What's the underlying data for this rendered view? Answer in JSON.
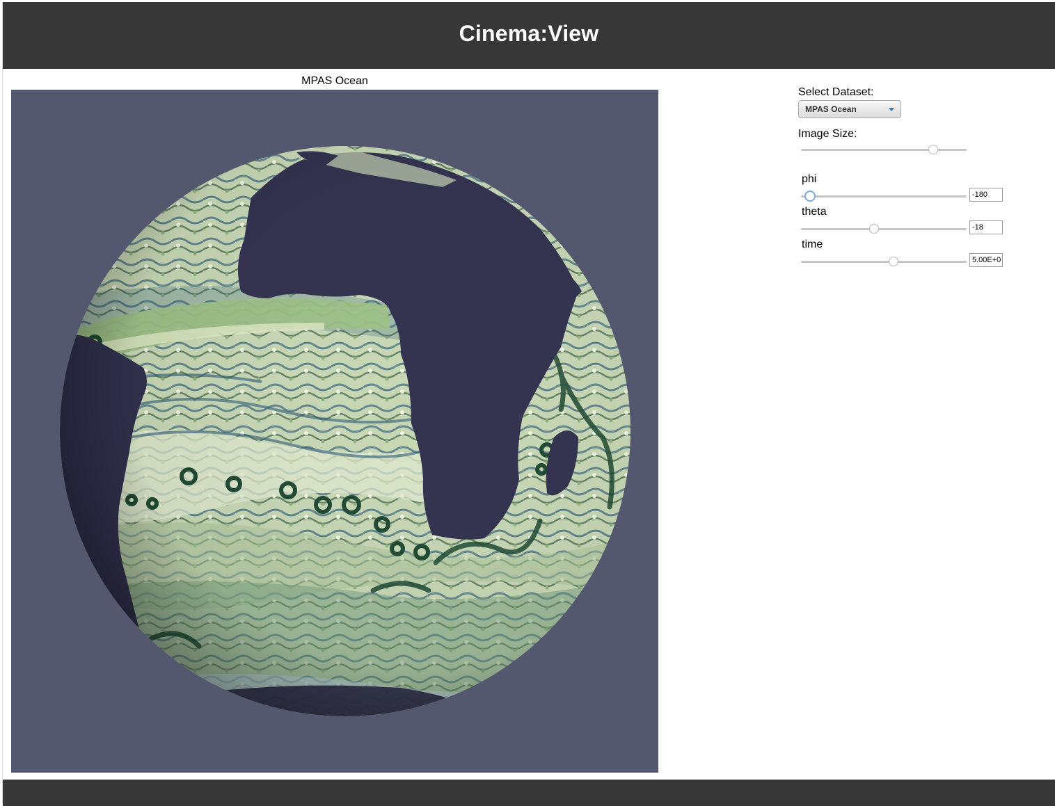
{
  "header": {
    "title": "Cinema:View"
  },
  "viewer": {
    "title": "MPAS Ocean"
  },
  "controls": {
    "dataset_label": "Select Dataset:",
    "dataset_selected": "MPAS Ocean",
    "image_size_label": "Image Size:",
    "image_size_level": 0.8,
    "params": [
      {
        "name": "phi",
        "value": "-180",
        "level": 0.03
      },
      {
        "name": "theta",
        "value": "-18",
        "level": 0.43
      },
      {
        "name": "time",
        "value": "5.00E+0",
        "level": 0.55
      }
    ]
  },
  "colors": {
    "header_bg": "#373737",
    "render_bg": "#54586f",
    "land": "#33324f",
    "ocean_light": "#dde6c6",
    "ocean_green": "#8fb27e",
    "ocean_dark": "#1f4a33",
    "ocean_blue": "#2d5a78"
  }
}
